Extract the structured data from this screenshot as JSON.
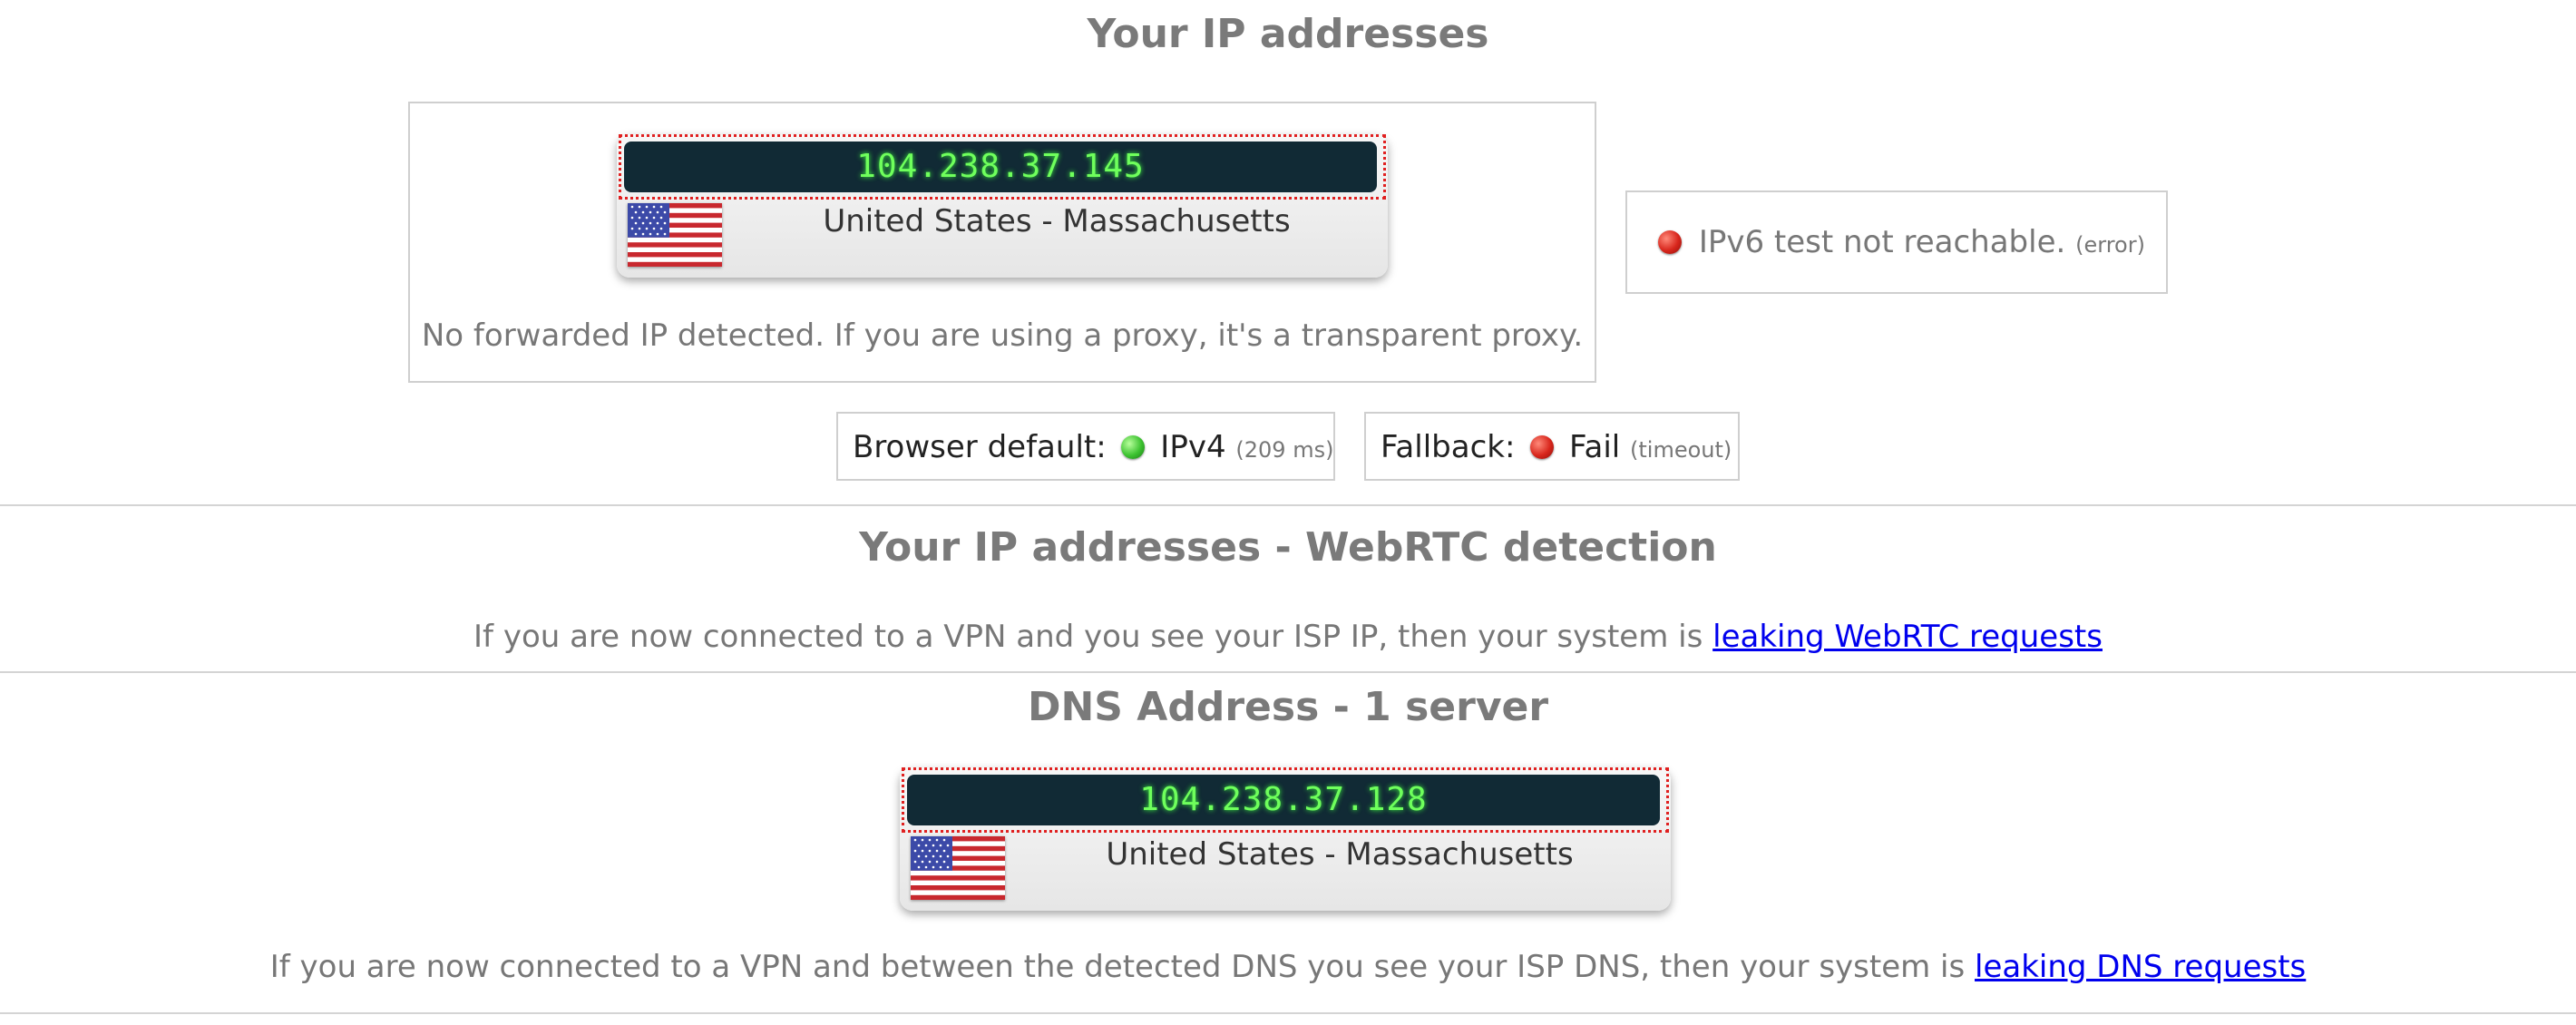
{
  "ip_section": {
    "title": "Your IP addresses",
    "ip_card": {
      "ip": "104.238.37.145",
      "location": "United States - Massachusetts",
      "flag_icon": "us-flag-icon"
    },
    "forwarded_text": "No forwarded IP detected. If you are using a proxy, it's a transparent proxy.",
    "ipv6": {
      "text": "IPv6 test not reachable.",
      "note": "(error)",
      "status_color": "#d8261c"
    },
    "browser_default": {
      "label": "Browser default:",
      "value": "IPv4",
      "note": "(209 ms)",
      "status_color": "#3cc230"
    },
    "fallback": {
      "label": "Fallback:",
      "value": "Fail",
      "note": "(timeout)",
      "status_color": "#d8261c"
    }
  },
  "webrtc_section": {
    "title": "Your IP addresses - WebRTC detection",
    "text": "If you are now connected to a VPN and you see your ISP IP, then your system is",
    "link_text": "leaking WebRTC requests"
  },
  "dns_section": {
    "title": "DNS Address - 1 server",
    "ip_card": {
      "ip": "104.238.37.128",
      "location": "United States - Massachusetts",
      "flag_icon": "us-flag-icon"
    },
    "text": "If you are now connected to a VPN and between the detected DNS you see your ISP DNS, then your system is",
    "link_text": "leaking DNS requests"
  },
  "colors": {
    "ip_bar_bg": "#112a35",
    "ip_text": "#6fff5c",
    "link": "#0000ee",
    "heading": "#7a7a7a"
  }
}
